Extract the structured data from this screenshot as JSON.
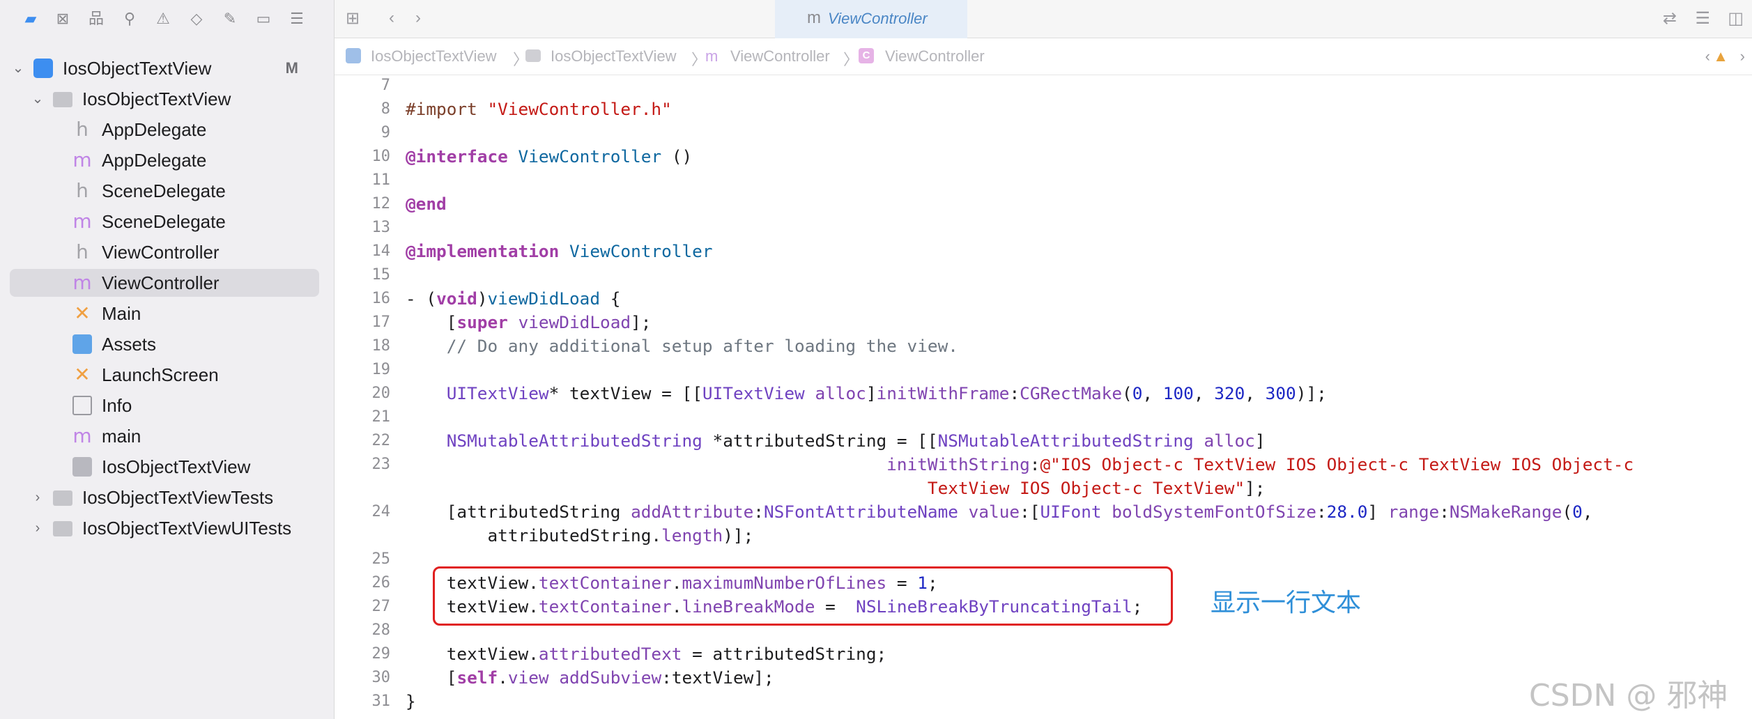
{
  "navigator": {
    "items": [
      {
        "label": "IosObjectTextView",
        "badge": "M",
        "icon": "project-icon"
      },
      {
        "label": "IosObjectTextView",
        "icon": "folder-icon"
      },
      {
        "label": "AppDelegate",
        "icon": "header-file-icon",
        "glyph": "h"
      },
      {
        "label": "AppDelegate",
        "icon": "objc-file-icon",
        "glyph": "m"
      },
      {
        "label": "SceneDelegate",
        "icon": "header-file-icon",
        "glyph": "h"
      },
      {
        "label": "SceneDelegate",
        "icon": "objc-file-icon",
        "glyph": "m"
      },
      {
        "label": "ViewController",
        "icon": "header-file-icon",
        "glyph": "h"
      },
      {
        "label": "ViewController",
        "icon": "objc-file-icon",
        "glyph": "m"
      },
      {
        "label": "Main",
        "icon": "storyboard-icon",
        "glyph": "✕"
      },
      {
        "label": "Assets",
        "icon": "asset-catalog-icon"
      },
      {
        "label": "LaunchScreen",
        "icon": "storyboard-icon",
        "glyph": "✕"
      },
      {
        "label": "Info",
        "icon": "plist-icon"
      },
      {
        "label": "main",
        "icon": "objc-file-icon",
        "glyph": "m"
      },
      {
        "label": "IosObjectTextView",
        "icon": "entitlements-icon"
      },
      {
        "label": "IosObjectTextViewTests",
        "icon": "folder-icon"
      },
      {
        "label": "IosObjectTextViewUITests",
        "icon": "folder-icon"
      }
    ]
  },
  "tab": {
    "glyph": "m",
    "title": "ViewController"
  },
  "jumpbar": {
    "project": "IosObjectTextView",
    "group": "IosObjectTextView",
    "file_glyph": "m",
    "file": "ViewController",
    "class_glyph": "C",
    "symbol": "ViewController"
  },
  "code": {
    "line_numbers": [
      "7",
      "8",
      "9",
      "10",
      "11",
      "12",
      "13",
      "14",
      "15",
      "16",
      "17",
      "18",
      "19",
      "20",
      "21",
      "22",
      "23",
      "",
      "24",
      "",
      "25",
      "26",
      "27",
      "28",
      "29",
      "30",
      "31"
    ],
    "l8_import": "#import",
    "l8_str": "\"ViewController.h\"",
    "l10_kw": "@interface",
    "l10_cls": "ViewController",
    "l10_rest": " ()",
    "l12_kw": "@end",
    "l14_kw": "@implementation",
    "l14_cls": "ViewController",
    "l16_a": "- (",
    "l16_void": "void",
    "l16_b": ")",
    "l16_name": "viewDidLoad",
    "l16_c": " {",
    "l17_a": "    [",
    "l17_super": "super",
    "l17_b": " ",
    "l17_m": "viewDidLoad",
    "l17_c": "];",
    "l18_cm": "    // Do any additional setup after loading the view.",
    "l20_a": "    ",
    "l20_t1": "UITextView",
    "l20_b": "* textView = [[",
    "l20_t2": "UITextView",
    "l20_c": " ",
    "l20_alloc": "alloc",
    "l20_d": "]",
    "l20_init": "initWithFrame",
    "l20_e": ":",
    "l20_fn": "CGRectMake",
    "l20_f": "(",
    "l20_n1": "0",
    "l20_g": ", ",
    "l20_n2": "100",
    "l20_h": ", ",
    "l20_n3": "320",
    "l20_i": ", ",
    "l20_n4": "300",
    "l20_j": ")];",
    "l22_a": "    ",
    "l22_t1": "NSMutableAttributedString",
    "l22_b": " *attributedString = [[",
    "l22_t2": "NSMutableAttributedString",
    "l22_c": " ",
    "l22_alloc": "alloc",
    "l22_d": "]",
    "l23_a": "                                               ",
    "l23_m": "initWithString",
    "l23_b": ":",
    "l23_str": "@\"IOS Object-c TextView IOS Object-c TextView IOS Object-c",
    "l23w_a": "                                                   ",
    "l23w_str": "TextView IOS Object-c TextView\"",
    "l23w_b": "];",
    "l24_a": "    [attributedString ",
    "l24_m1": "addAttribute",
    "l24_b": ":",
    "l24_t1": "NSFontAttributeName",
    "l24_c": " ",
    "l24_m2": "value",
    "l24_d": ":[",
    "l24_t2": "UIFont",
    "l24_e": " ",
    "l24_m3": "boldSystemFontOfSize",
    "l24_f": ":",
    "l24_n1": "28.0",
    "l24_g": "] ",
    "l24_m4": "range",
    "l24_h": ":",
    "l24_fn": "NSMakeRange",
    "l24_i": "(",
    "l24_n2": "0",
    "l24_j": ",",
    "l24w_a": "        attributedString.",
    "l24w_p": "length",
    "l24w_b": ")];",
    "l26_a": "    textView.",
    "l26_p1": "textContainer",
    "l26_b": ".",
    "l26_p2": "maximumNumberOfLines",
    "l26_c": " = ",
    "l26_n": "1",
    "l26_d": ";",
    "l27_a": "    textView.",
    "l27_p1": "textContainer",
    "l27_b": ".",
    "l27_p2": "lineBreakMode",
    "l27_c": " =  ",
    "l27_v": "NSLineBreakByTruncatingTail",
    "l27_d": ";",
    "l29_a": "    textView.",
    "l29_p": "attributedText",
    "l29_b": " = attributedString;",
    "l30_a": "    [",
    "l30_self": "self",
    "l30_b": ".",
    "l30_p": "view",
    "l30_c": " ",
    "l30_m": "addSubview",
    "l30_d": ":textView];",
    "l31": "}"
  },
  "annotation": "显示一行文本",
  "watermark": "CSDN @  邪神"
}
